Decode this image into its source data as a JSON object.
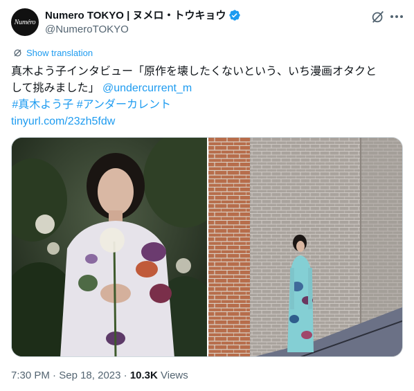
{
  "account": {
    "avatar_text": "Numéro",
    "display_name": "Numero TOKYO | ヌメロ・トウキョウ",
    "handle": "@NumeroTOKYO"
  },
  "translation": {
    "label": "Show translation"
  },
  "tweet": {
    "line1": "真木よう子インタビュー「原作を壊したくないという、いち漫画オタクと",
    "line2_text": "して挑みました」 ",
    "mention": "@undercurrent_m",
    "hashtag1": "#真木よう子",
    "hashtag2": "#アンダーカレント",
    "url": "tinyurl.com/23zh5fdw"
  },
  "meta": {
    "time": "7:30 PM",
    "sep1": " · ",
    "date": "Sep 18, 2023",
    "sep2": " · ",
    "views_count": "10.3K",
    "views_label": " Views"
  },
  "colors": {
    "accent": "#1d9bf0",
    "text": "#0f1419",
    "secondary": "#536471",
    "border": "#cfd9de"
  },
  "icons": [
    "verified-badge-icon",
    "grok-icon",
    "more-icon",
    "translate-icon"
  ]
}
